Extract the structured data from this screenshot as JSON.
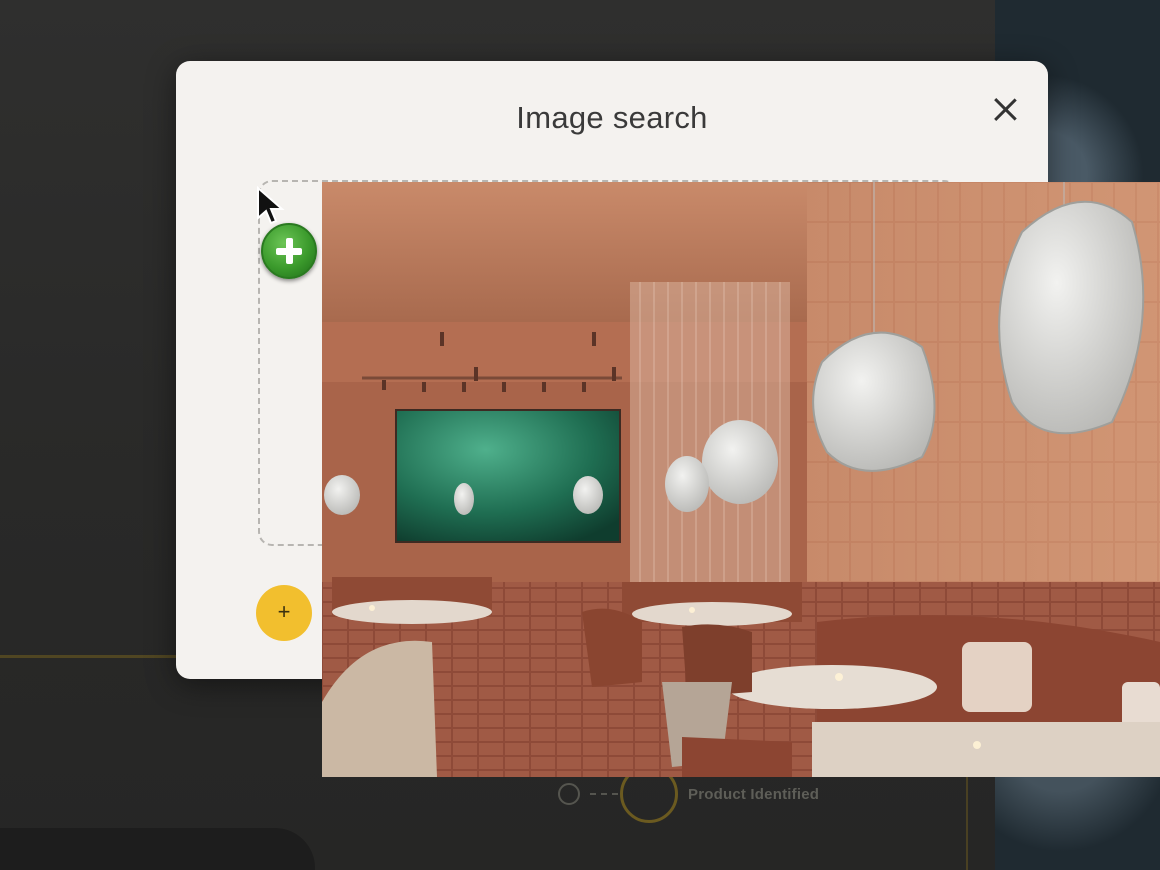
{
  "modal": {
    "title": "Image search",
    "close_icon": "close-icon",
    "add_button_label": "+"
  },
  "background": {
    "progress_label": "Product Identified"
  },
  "drag": {
    "badge_icon": "plus-copy-icon",
    "cursor_icon": "pointer-cursor-icon"
  },
  "colors": {
    "accent_yellow": "#f2bf2e",
    "modal_bg": "#f4f2ef",
    "badge_green": "#3b9a2c"
  }
}
